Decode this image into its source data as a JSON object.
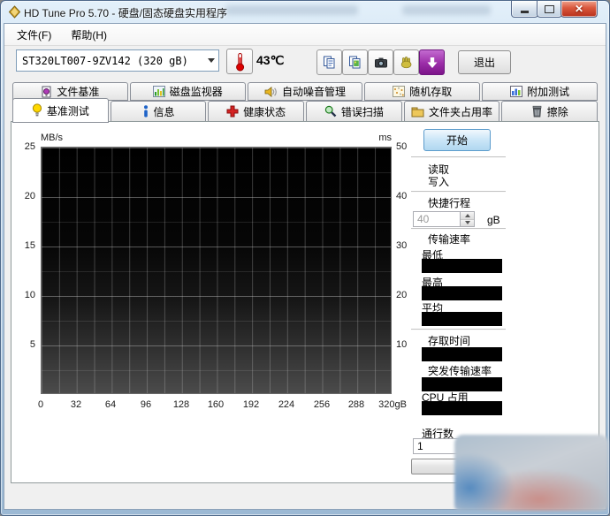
{
  "window": {
    "title": "HD Tune Pro 5.70 - 硬盘/固态硬盘实用程序"
  },
  "menu": {
    "file": "文件(F)",
    "help": "帮助(H)"
  },
  "toolbar": {
    "drive_select": "ST320LT007-9ZV142 (320 gB)",
    "temperature": "43℃",
    "exit": "退出"
  },
  "tabs_row1": [
    {
      "label": "文件基准"
    },
    {
      "label": "磁盘监视器"
    },
    {
      "label": "自动噪音管理"
    },
    {
      "label": "随机存取"
    },
    {
      "label": "附加测试"
    }
  ],
  "tabs_row2": [
    {
      "label": "基准测试",
      "active": true
    },
    {
      "label": "信息"
    },
    {
      "label": "健康状态"
    },
    {
      "label": "错误扫描"
    },
    {
      "label": "文件夹占用率"
    },
    {
      "label": "擦除"
    }
  ],
  "chart_data": {
    "type": "line",
    "title": "",
    "series": [],
    "grid": "on",
    "plot_background": "#000000",
    "left_axis": {
      "label": "MB/s",
      "range": [
        0,
        25
      ],
      "ticks": [
        "25",
        "20",
        "15",
        "10",
        "5"
      ]
    },
    "right_axis": {
      "label": "ms",
      "range": [
        0,
        50
      ],
      "ticks": [
        "50",
        "40",
        "30",
        "20",
        "10"
      ]
    },
    "x_axis": {
      "range": [
        0,
        320
      ],
      "ticks": [
        "0",
        "32",
        "64",
        "96",
        "128",
        "160",
        "192",
        "224",
        "256",
        "288",
        "320gB"
      ]
    }
  },
  "panel": {
    "start": "开始",
    "read": "读取",
    "write": "写入",
    "short_stroke": "快捷行程",
    "short_stroke_value": "40",
    "short_stroke_unit": "gB",
    "transfer_rate": "传输速率",
    "min": "最低",
    "max": "最高",
    "avg": "平均",
    "access_time": "存取时间",
    "burst_rate": "突发传输速率",
    "cpu_usage": "CPU 占用",
    "pass_count": "通行数",
    "pass_count_value": "1"
  },
  "colors": {
    "accent_purple": "#9b2da8",
    "temp_red": "#cc1111",
    "plot_background": "#000000",
    "frame_blue": "#bdd3e8"
  }
}
